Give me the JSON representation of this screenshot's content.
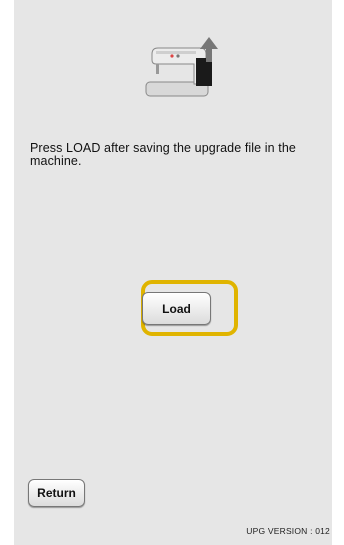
{
  "screen": {
    "icon": "sewing-machine-upload-icon",
    "message": "Press LOAD after saving the upgrade file in the machine.",
    "accent_color": "#e0b400",
    "panel_color": "#e6e6e6"
  },
  "buttons": {
    "load_label": "Load",
    "return_label": "Return"
  },
  "footer": {
    "version_text": "UPG VERSION : 012"
  }
}
